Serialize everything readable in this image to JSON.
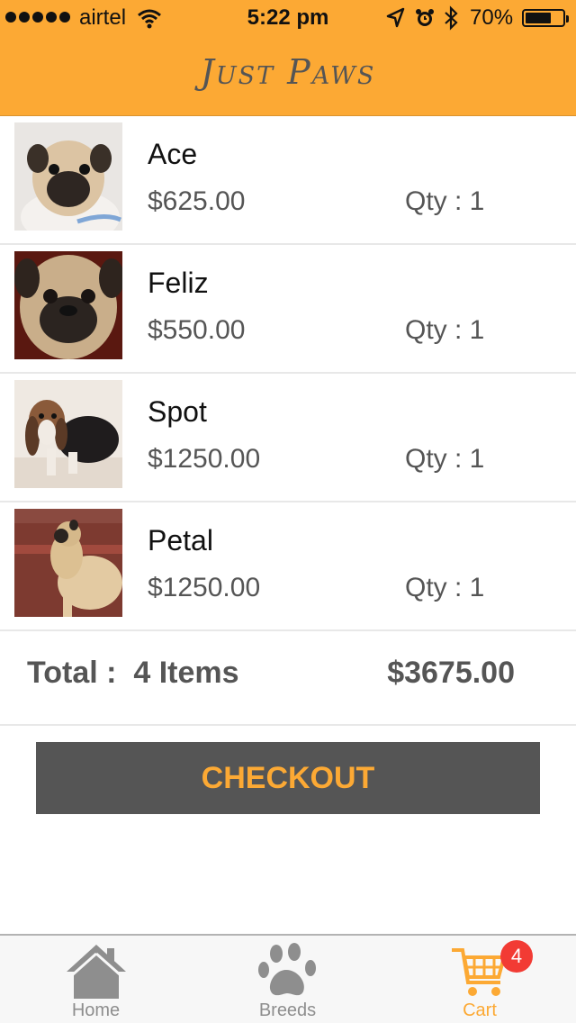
{
  "status_bar": {
    "carrier": "airtel",
    "time": "5:22 pm",
    "battery_percent": "70%",
    "battery_level": 0.7
  },
  "header": {
    "logo_text": "Just Paws"
  },
  "cart": {
    "items": [
      {
        "name": "Ace",
        "price": "$625.00",
        "qty": "Qty : 1",
        "image": "pug-puppy-photo"
      },
      {
        "name": "Feliz",
        "price": "$550.00",
        "qty": "Qty : 1",
        "image": "pug-face-photo"
      },
      {
        "name": "Spot",
        "price": "$1250.00",
        "qty": "Qty : 1",
        "image": "basset-hound-puppy-photo"
      },
      {
        "name": "Petal",
        "price": "$1250.00",
        "qty": "Qty : 1",
        "image": "pug-side-photo"
      }
    ],
    "total_label": "Total :  4 Items",
    "total_amount": "$3675.00",
    "checkout_label": "CHECKOUT"
  },
  "tabbar": {
    "tabs": [
      {
        "label": "Home",
        "icon": "home-icon",
        "active": false
      },
      {
        "label": "Breeds",
        "icon": "paw-icon",
        "active": false
      },
      {
        "label": "Cart",
        "icon": "cart-icon",
        "active": true
      }
    ],
    "cart_badge": "4"
  },
  "colors": {
    "accent": "#fca934",
    "dark_button": "#555555",
    "badge": "#f23b34",
    "inactive_tab": "#8e8e8e"
  }
}
